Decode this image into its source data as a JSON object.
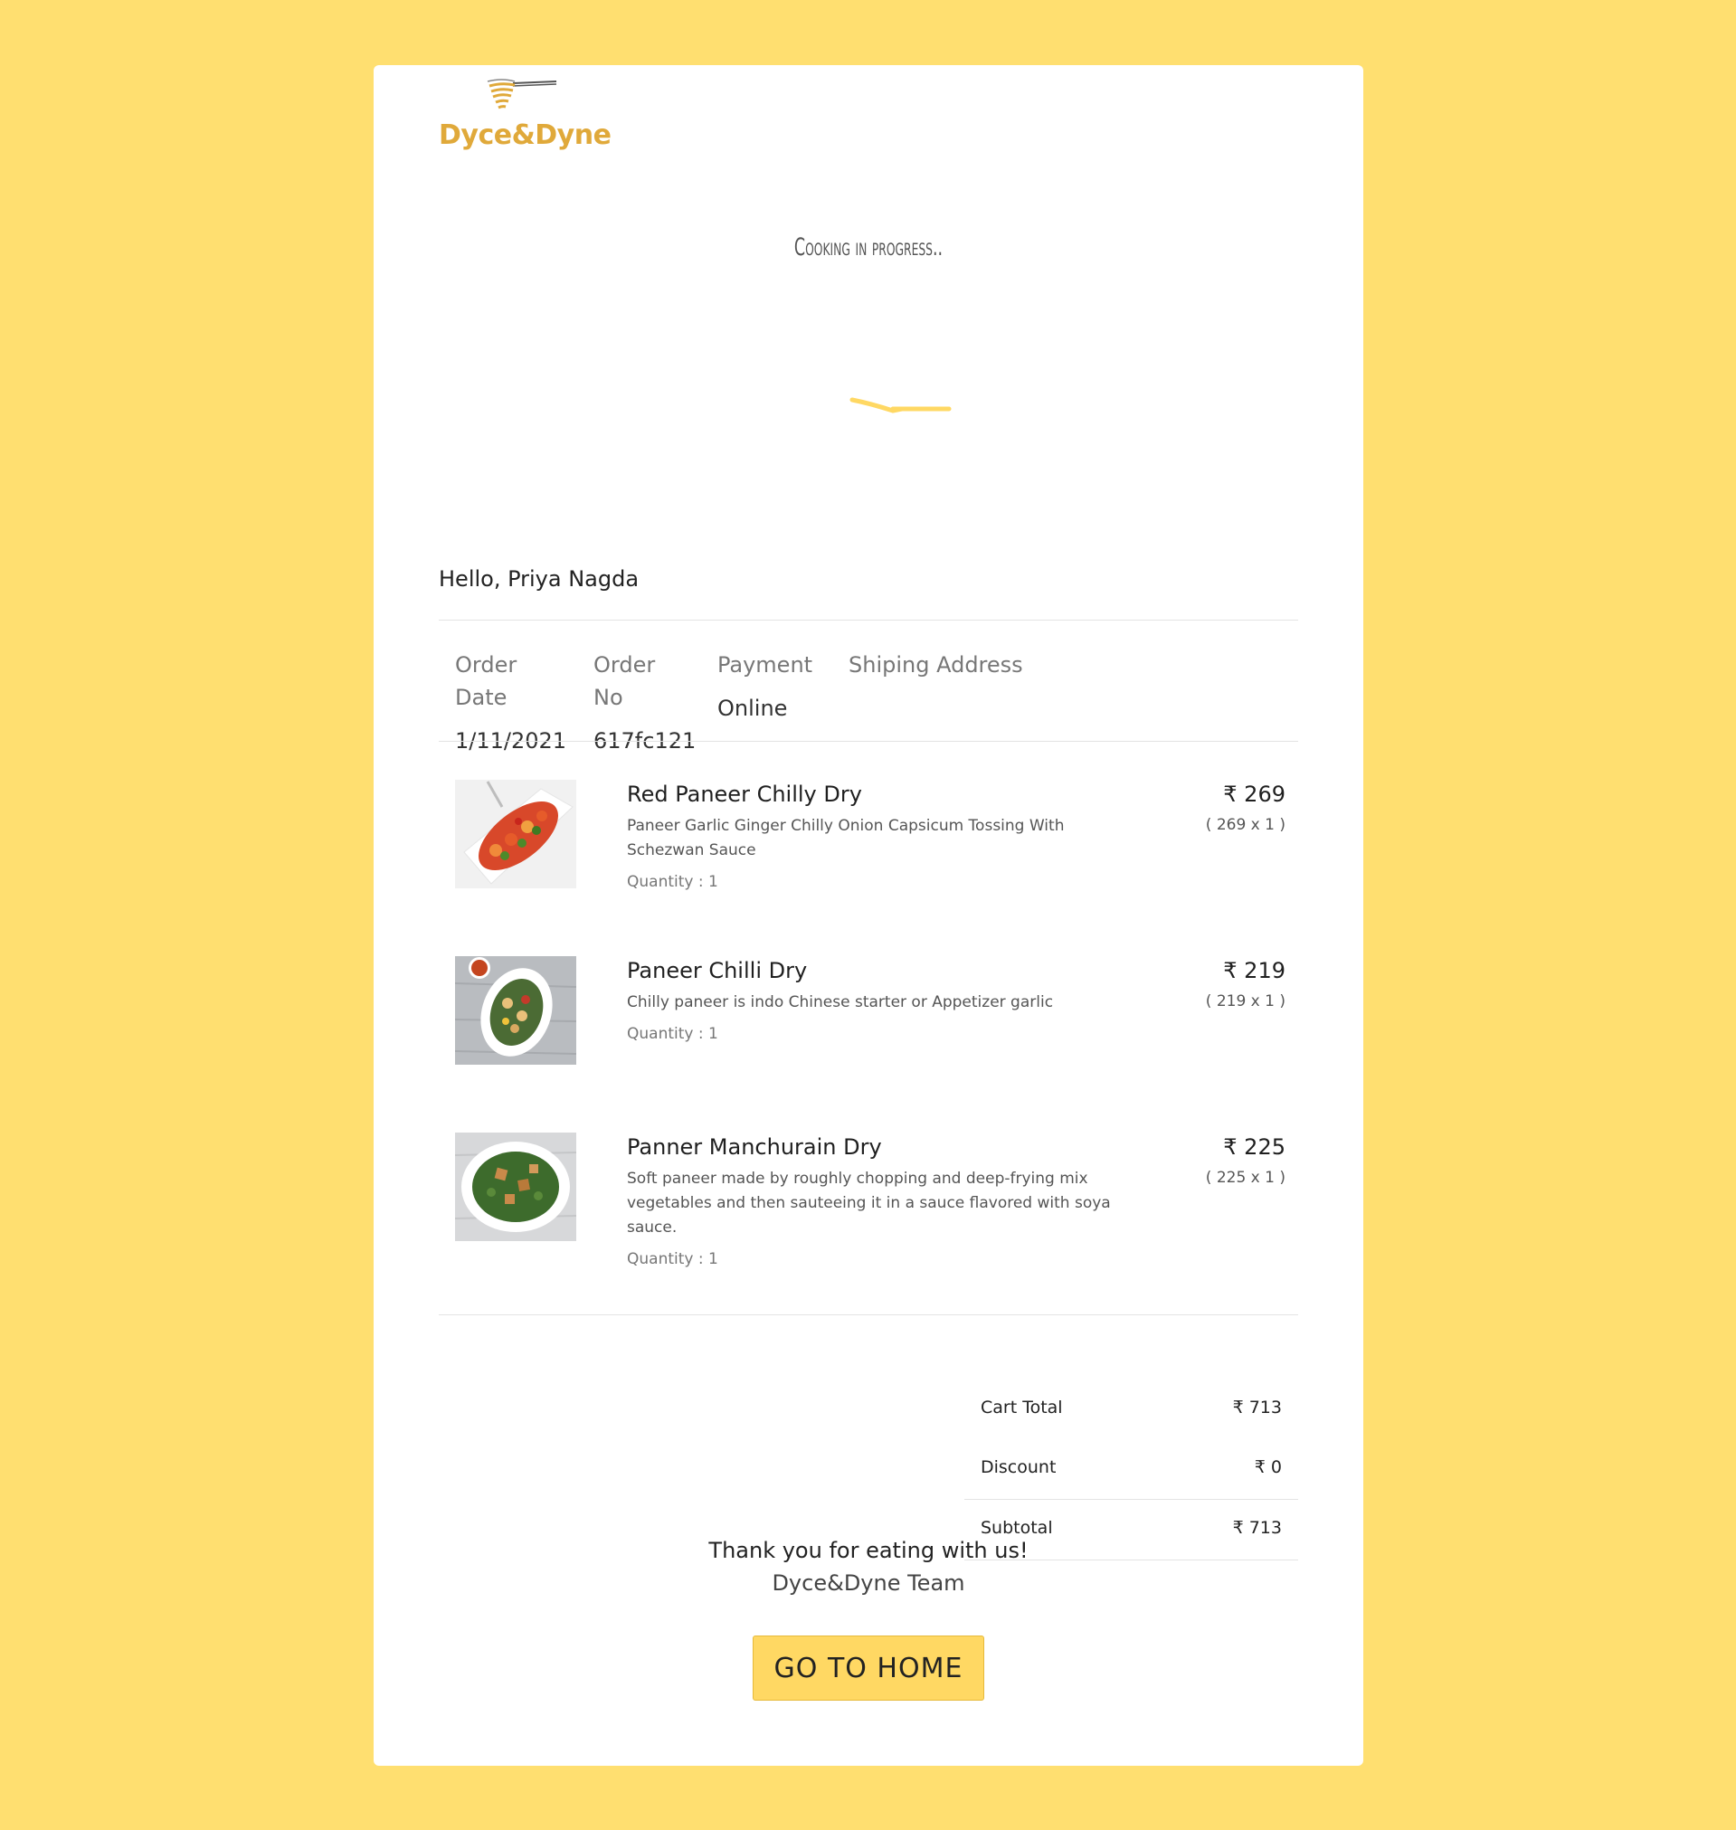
{
  "brand": {
    "name": "Dyce&Dyne",
    "color": "#e0a93a"
  },
  "status": {
    "text": "Cooking in progress.."
  },
  "greeting": "Hello, Priya Nagda",
  "order_info": {
    "date_label_1": "Order",
    "date_label_2": "Date",
    "date_value": "1/11/2021",
    "no_label_1": "Order",
    "no_label_2": "No",
    "no_value": "617fc121",
    "payment_label": "Payment",
    "payment_value": "Online",
    "address_label": "Shiping Address"
  },
  "items": [
    {
      "name": "Red Paneer Chilly Dry",
      "description": "Paneer Garlic Ginger Chilly Onion Capsicum Tossing With Schezwan Sauce",
      "quantity": "Quantity : 1",
      "price": "₹ 269",
      "calc": "( 269 x 1 )"
    },
    {
      "name": "Paneer Chilli Dry",
      "description": "Chilly paneer is indo Chinese starter or Appetizer garlic",
      "quantity": "Quantity : 1",
      "price": "₹ 219",
      "calc": "( 219 x 1 )"
    },
    {
      "name": "Panner Manchurain Dry",
      "description": "Soft paneer made by roughly chopping and deep-frying mix vegetables and then sauteeing it in a sauce flavored with soya sauce.",
      "quantity": "Quantity : 1",
      "price": "₹ 225",
      "calc": "( 225 x 1 )"
    }
  ],
  "totals": {
    "cart_total_label": "Cart Total",
    "cart_total_value": "₹ 713",
    "discount_label": "Discount",
    "discount_value": "₹ 0",
    "subtotal_label": "Subtotal",
    "subtotal_value": "₹ 713"
  },
  "footer": {
    "thanks": "Thank you for eating with us!",
    "team": "Dyce&Dyne Team",
    "home_button": "GO TO HOME"
  },
  "colors": {
    "background": "#ffdf70",
    "button": "#ffd863",
    "accent": "#e0a93a"
  }
}
